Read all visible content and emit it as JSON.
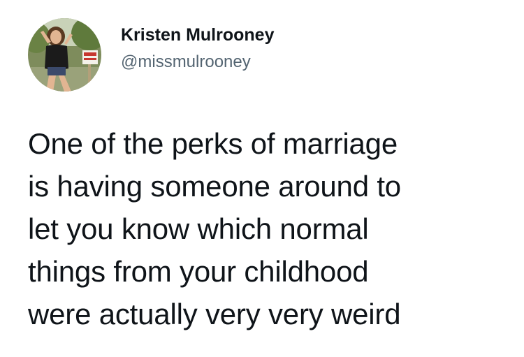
{
  "author": {
    "display_name": "Kristen Mulrooney",
    "handle": "@missmulrooney"
  },
  "tweet": {
    "lines": [
      "One of the perks of marriage",
      "is having someone around to",
      "let you know which normal",
      "things from your childhood",
      "were actually very very weird"
    ]
  },
  "colors": {
    "background": "#ffffff",
    "text_primary": "#0f1419",
    "text_secondary": "#536471"
  },
  "icons": {
    "avatar": "profile-photo"
  }
}
